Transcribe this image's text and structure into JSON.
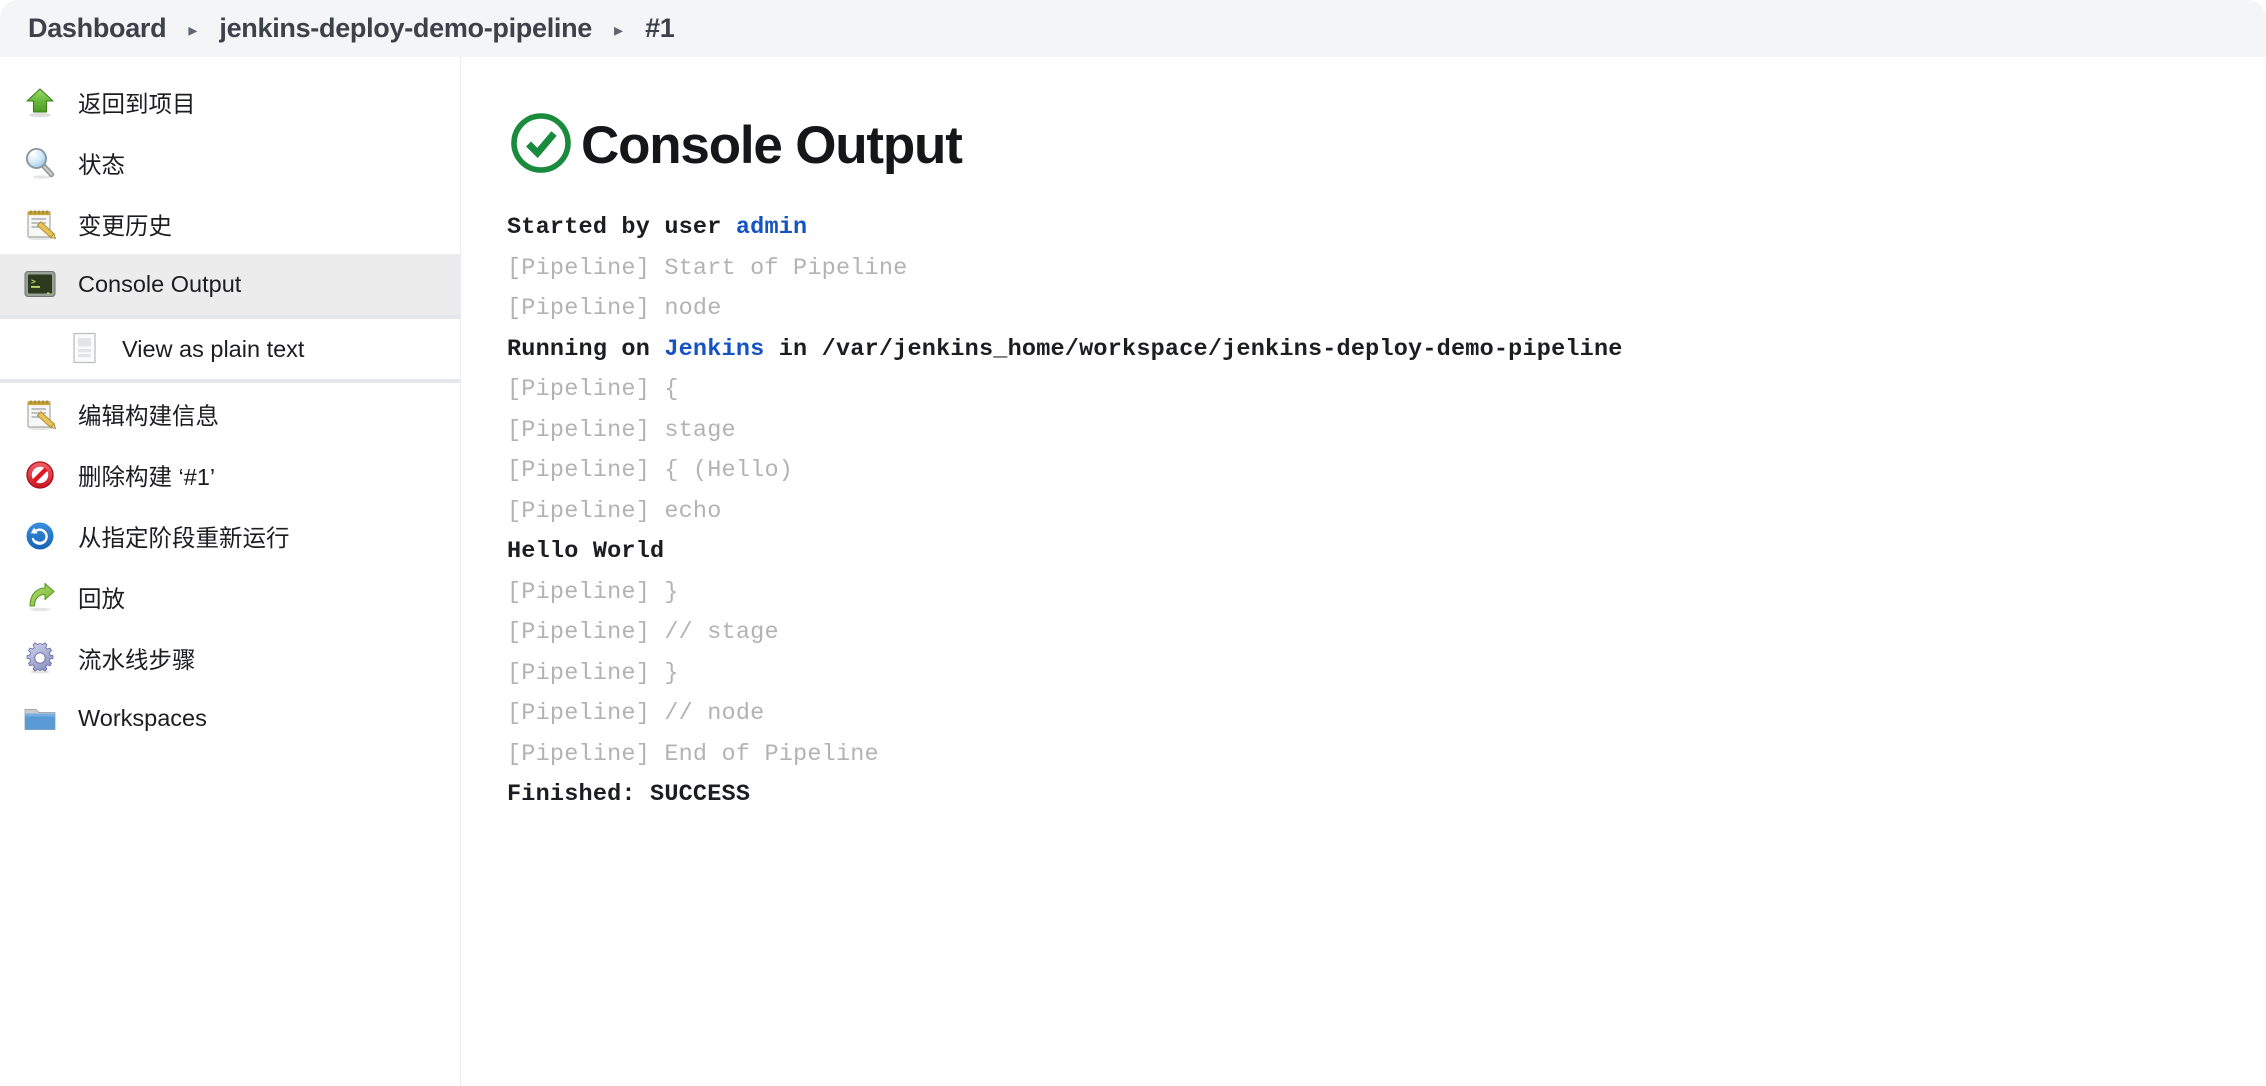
{
  "breadcrumb": {
    "items": [
      {
        "label": "Dashboard",
        "name": "breadcrumb-dashboard"
      },
      {
        "label": "jenkins-deploy-demo-pipeline",
        "name": "breadcrumb-job"
      },
      {
        "label": "#1",
        "name": "breadcrumb-build"
      }
    ],
    "separator": "▸"
  },
  "sidebar": {
    "groups": [
      {
        "items": [
          {
            "label": "返回到项目",
            "icon": "up-arrow-icon",
            "name": "sidebar-item-back-to-project",
            "active": false
          },
          {
            "label": "状态",
            "icon": "magnifier-icon",
            "name": "sidebar-item-status",
            "active": false
          },
          {
            "label": "变更历史",
            "icon": "notepad-pencil-icon",
            "name": "sidebar-item-changes",
            "active": false
          },
          {
            "label": "Console Output",
            "icon": "terminal-icon",
            "name": "sidebar-item-console-output",
            "active": true
          }
        ]
      },
      {
        "subitems": [
          {
            "label": "View as plain text",
            "icon": "document-icon",
            "name": "sidebar-subitem-view-as-plain-text"
          }
        ]
      },
      {
        "items": [
          {
            "label": "编辑构建信息",
            "icon": "notepad-pencil-icon",
            "name": "sidebar-item-edit-build-information",
            "active": false
          },
          {
            "label": "删除构建 ‘#1’",
            "icon": "no-entry-icon",
            "name": "sidebar-item-delete-build",
            "active": false
          },
          {
            "label": "从指定阶段重新运行",
            "icon": "restart-circle-icon",
            "name": "sidebar-item-restart-from-stage",
            "active": false
          },
          {
            "label": "回放",
            "icon": "replay-arrow-icon",
            "name": "sidebar-item-replay",
            "active": false
          },
          {
            "label": "流水线步骤",
            "icon": "gear-icon",
            "name": "sidebar-item-pipeline-steps",
            "active": false
          },
          {
            "label": "Workspaces",
            "icon": "folder-icon",
            "name": "sidebar-item-workspaces",
            "active": false
          }
        ]
      }
    ]
  },
  "main": {
    "status_icon": "success-check-circle-icon",
    "title": "Console Output",
    "log": [
      {
        "name": "log-line-started-by-user",
        "segments": [
          {
            "text": "Started by user ",
            "style": "bold"
          },
          {
            "text": "admin",
            "style": "link"
          }
        ]
      },
      {
        "name": "log-line-start-of-pipeline",
        "segments": [
          {
            "text": "[Pipeline] Start of Pipeline",
            "style": "muted"
          }
        ]
      },
      {
        "name": "log-line-node",
        "segments": [
          {
            "text": "[Pipeline] node",
            "style": "muted"
          }
        ]
      },
      {
        "name": "log-line-running-on",
        "segments": [
          {
            "text": "Running on ",
            "style": "bold"
          },
          {
            "text": "Jenkins",
            "style": "link"
          },
          {
            "text": " in /var/jenkins_home/workspace/jenkins-deploy-demo-pipeline",
            "style": "bold"
          }
        ]
      },
      {
        "name": "log-line-open-brace",
        "segments": [
          {
            "text": "[Pipeline] {",
            "style": "muted"
          }
        ]
      },
      {
        "name": "log-line-stage",
        "segments": [
          {
            "text": "[Pipeline] stage",
            "style": "muted"
          }
        ]
      },
      {
        "name": "log-line-stage-hello",
        "segments": [
          {
            "text": "[Pipeline] { (Hello)",
            "style": "muted"
          }
        ]
      },
      {
        "name": "log-line-echo",
        "segments": [
          {
            "text": "[Pipeline] echo",
            "style": "muted"
          }
        ]
      },
      {
        "name": "log-line-hello-world",
        "segments": [
          {
            "text": "Hello World",
            "style": "bold"
          }
        ]
      },
      {
        "name": "log-line-close-brace-1",
        "segments": [
          {
            "text": "[Pipeline] }",
            "style": "muted"
          }
        ]
      },
      {
        "name": "log-line-end-stage",
        "segments": [
          {
            "text": "[Pipeline] // stage",
            "style": "muted"
          }
        ]
      },
      {
        "name": "log-line-close-brace-2",
        "segments": [
          {
            "text": "[Pipeline] }",
            "style": "muted"
          }
        ]
      },
      {
        "name": "log-line-end-node",
        "segments": [
          {
            "text": "[Pipeline] // node",
            "style": "muted"
          }
        ]
      },
      {
        "name": "log-line-end-of-pipeline",
        "segments": [
          {
            "text": "[Pipeline] End of Pipeline",
            "style": "muted"
          }
        ]
      },
      {
        "name": "log-line-finished",
        "segments": [
          {
            "text": "Finished: SUCCESS",
            "style": "bold"
          }
        ]
      }
    ]
  },
  "colors": {
    "success_green": "#1a8a3c",
    "link_blue": "#1453c4",
    "header_bg": "#f4f5f7",
    "active_row_bg": "#ececec",
    "muted_text": "#b3b3b3"
  }
}
